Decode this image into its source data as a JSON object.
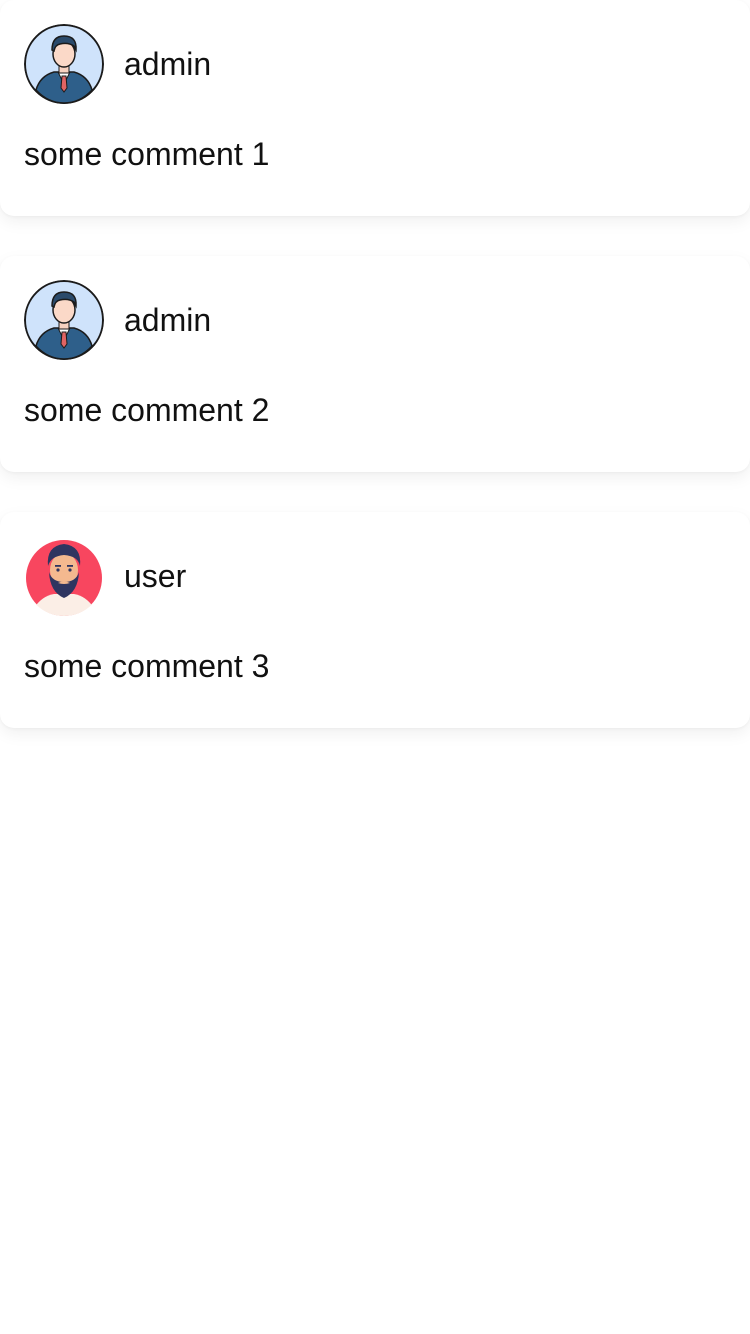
{
  "comments": [
    {
      "author": "admin",
      "avatar_icon": "businessman-avatar-icon",
      "text": "some comment 1"
    },
    {
      "author": "admin",
      "avatar_icon": "businessman-avatar-icon",
      "text": "some comment 2"
    },
    {
      "author": "user",
      "avatar_icon": "bearded-man-avatar-icon",
      "text": "some comment 3"
    }
  ],
  "colors": {
    "admin_avatar_bg": "#cfe3fb",
    "user_avatar_bg": "#f8465f",
    "text": "#111111"
  }
}
